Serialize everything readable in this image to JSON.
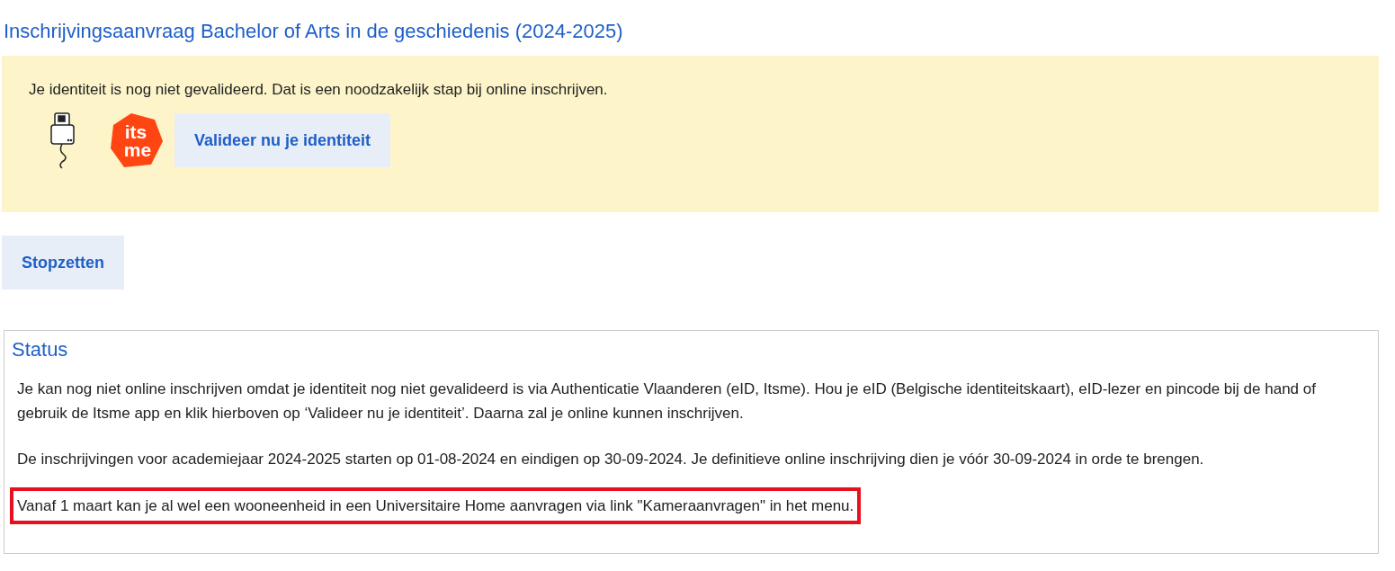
{
  "title": "Inschrijvingsaanvraag Bachelor of Arts in de geschiedenis (2024-2025)",
  "alert": {
    "message": "Je identiteit is nog niet gevalideerd. Dat is een noodzakelijk stap bij online inschrijven.",
    "logo_text": [
      "its",
      "me"
    ],
    "button": "Valideer nu je identiteit"
  },
  "stop_button": "Stopzetten",
  "status": {
    "heading": "Status",
    "paragraphs": [
      {
        "text": "Je kan nog niet online inschrijven omdat je identiteit nog niet gevalideerd is via Authenticatie Vlaanderen (eID, Itsme). Hou je eID (Belgische identiteitskaart), eID-lezer en pincode bij de hand of gebruik de Itsme app en klik hierboven op ‘Valideer nu je identiteit’. Daarna zal je online kunnen inschrijven.",
        "highlighted": false
      },
      {
        "text": "De inschrijvingen voor academiejaar 2024-2025 starten op 01-08-2024 en eindigen op 30-09-2024. Je definitieve online inschrijving dien je vóór 30-09-2024 in orde te brengen.",
        "highlighted": false
      },
      {
        "text": "Vanaf 1 maart kan je al wel een wooneenheid in een Universitaire Home aanvragen via link \"Kameraanvragen\" in het menu.",
        "highlighted": true
      }
    ]
  }
}
